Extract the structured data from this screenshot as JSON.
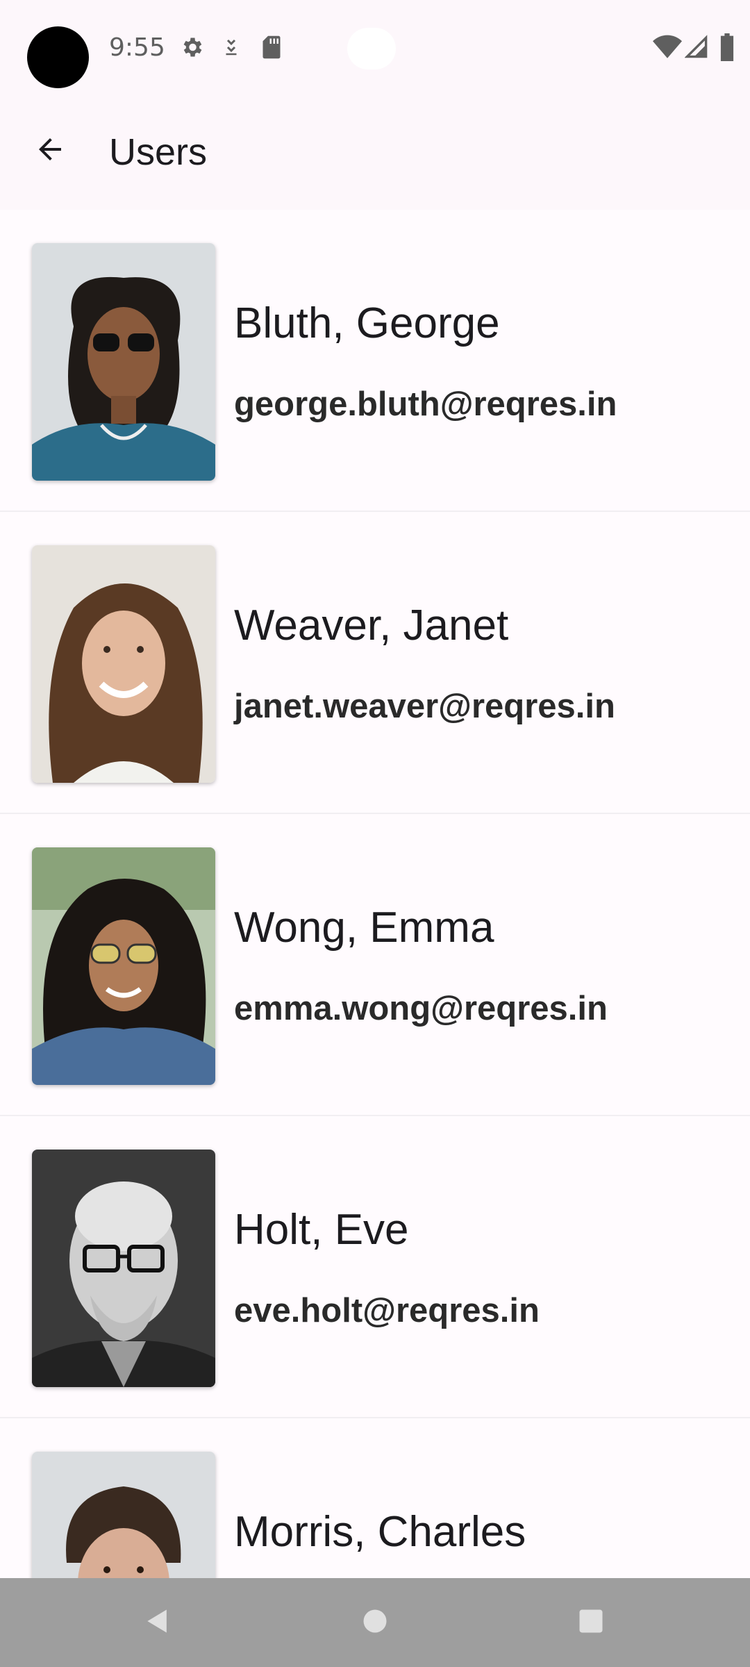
{
  "status_bar": {
    "time": "9:55",
    "icons": [
      "gear-icon",
      "download-icon",
      "sd-card-icon",
      "wifi-icon",
      "cell-signal-icon",
      "battery-icon"
    ]
  },
  "app_bar": {
    "title": "Users",
    "back_icon": "arrow-back-icon"
  },
  "users": [
    {
      "name": "Bluth, George",
      "email": "george.bluth@reqres.in"
    },
    {
      "name": "Weaver, Janet",
      "email": "janet.weaver@reqres.in"
    },
    {
      "name": "Wong, Emma",
      "email": "emma.wong@reqres.in"
    },
    {
      "name": "Holt, Eve",
      "email": "eve.holt@reqres.in"
    },
    {
      "name": "Morris, Charles",
      "email": ""
    }
  ],
  "nav_bar": {
    "buttons": [
      "back-triangle-icon",
      "home-circle-icon",
      "recents-square-icon"
    ]
  },
  "colors": {
    "background": "#fffbfe",
    "app_bar": "#fdf7fb",
    "nav_bar": "#9e9e9e",
    "text_primary": "#1c1b1f"
  }
}
